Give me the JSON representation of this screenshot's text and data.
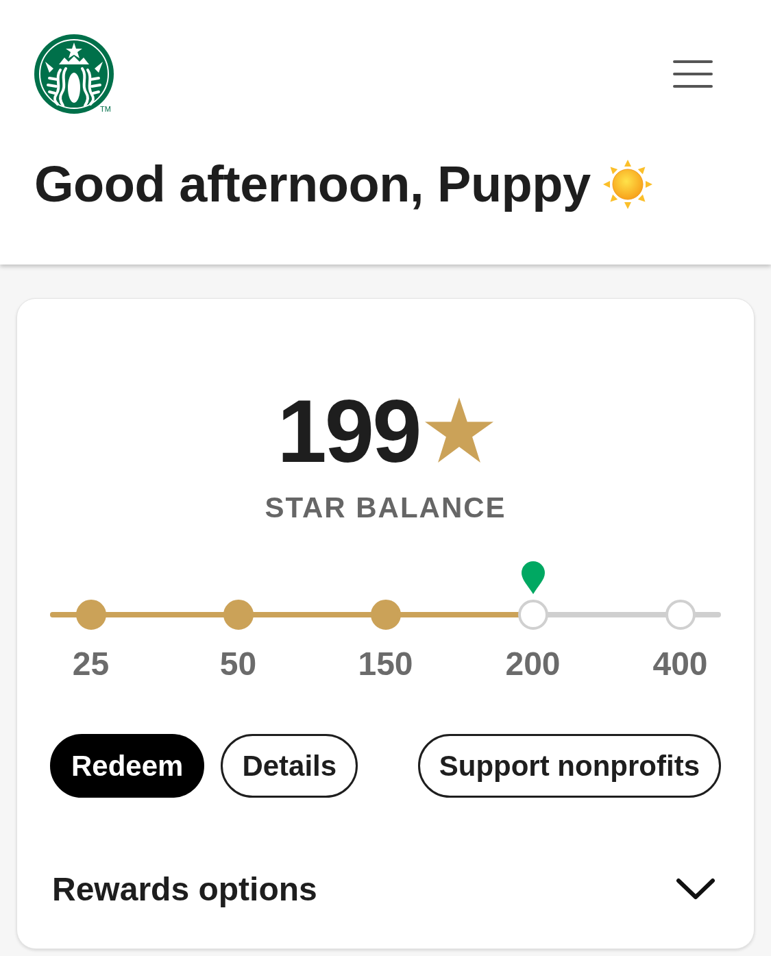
{
  "header": {
    "logo": {
      "trademark": "TM"
    },
    "greeting": "Good afternoon, Puppy"
  },
  "rewards_card": {
    "balance": "199",
    "balance_label": "STAR BALANCE",
    "progress": {
      "level": 0.72,
      "milestones": [
        {
          "label": "25",
          "reached": true
        },
        {
          "label": "50",
          "reached": true
        },
        {
          "label": "150",
          "reached": true
        },
        {
          "label": "200",
          "reached": false
        },
        {
          "label": "400",
          "reached": false
        }
      ]
    },
    "buttons": [
      {
        "label": "Redeem",
        "kind": "primary"
      },
      {
        "label": "Details",
        "kind": "outline"
      },
      {
        "label": "Support nonprofits",
        "kind": "outline"
      }
    ],
    "rewards_options": {
      "label": "Rewards options",
      "expanded": false
    }
  }
}
